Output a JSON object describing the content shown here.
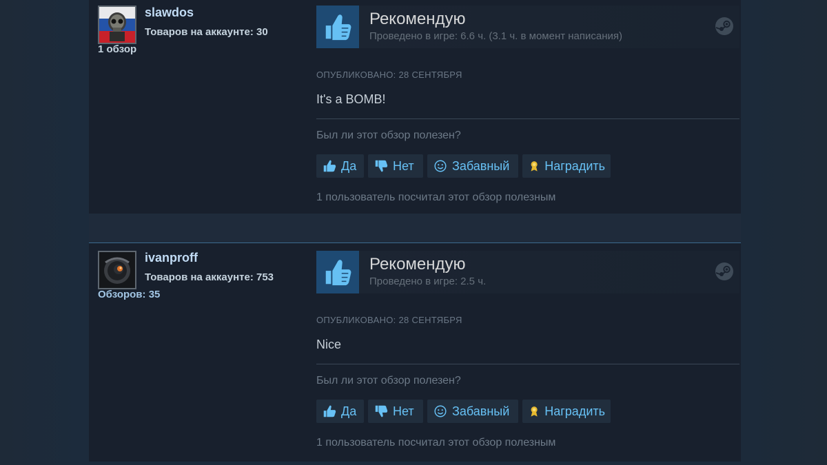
{
  "colors": {
    "accent": "#67c1f5",
    "background": "#1b2838",
    "review_bg": "#18202d",
    "thumb_bg": "#1e4a73"
  },
  "reviews": [
    {
      "author": {
        "name": "slawdos",
        "products": "Товаров на аккаунте: 30",
        "reviews": "1 обзор",
        "avatar_icon": "skull-flag-avatar"
      },
      "vote": {
        "title": "Рекомендую",
        "hours": "Проведено в игре: 6.6 ч. (3.1 ч. в момент написания)",
        "thumb_icon": "thumbs-up-icon",
        "platform_icon": "steam-icon"
      },
      "posted": "ОПУБЛИКОВАНО: 28 СЕНТЯБРЯ",
      "text": "It's a BOMB!",
      "helpful_question": "Был ли этот обзор полезен?",
      "buttons": {
        "yes": "Да",
        "no": "Нет",
        "funny": "Забавный",
        "award": "Наградить"
      },
      "helpful_count": "1 пользователь посчитал этот обзор полезным"
    },
    {
      "author": {
        "name": "ivanproff",
        "products": "Товаров на аккаунте: 753",
        "reviews": "Обзоров: 35",
        "avatar_icon": "robot-eye-avatar"
      },
      "vote": {
        "title": "Рекомендую",
        "hours": "Проведено в игре: 2.5 ч.",
        "thumb_icon": "thumbs-up-icon",
        "platform_icon": "steam-icon"
      },
      "posted": "ОПУБЛИКОВАНО: 28 СЕНТЯБРЯ",
      "text": "Nice",
      "helpful_question": "Был ли этот обзор полезен?",
      "buttons": {
        "yes": "Да",
        "no": "Нет",
        "funny": "Забавный",
        "award": "Наградить"
      },
      "helpful_count": "1 пользователь посчитал этот обзор полезным"
    }
  ]
}
